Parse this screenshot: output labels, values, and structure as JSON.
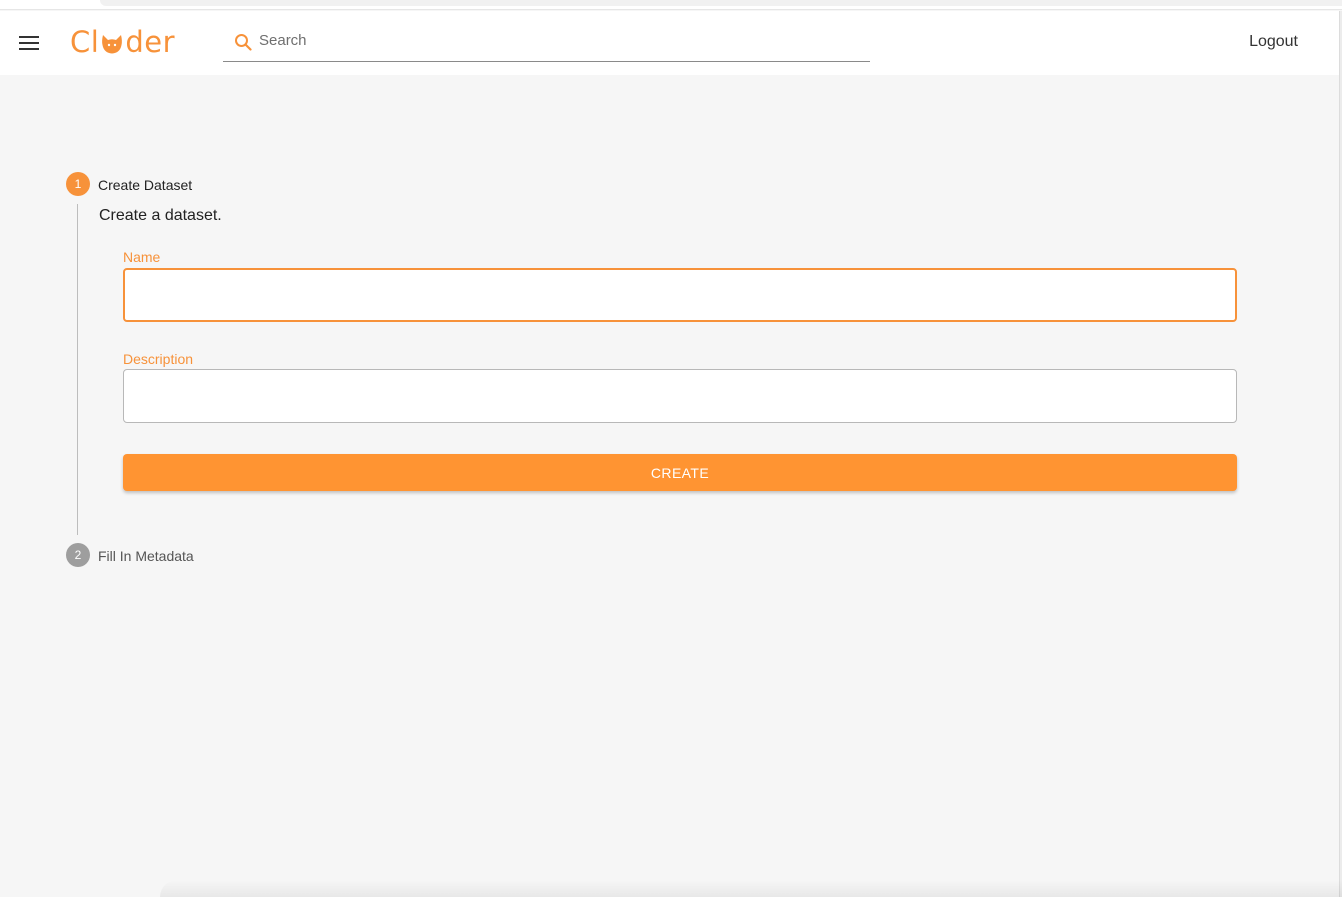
{
  "app": {
    "logo_text_left": "Cl",
    "logo_text_right": "der",
    "brand_color": "#f7923a"
  },
  "header": {
    "menu_icon": "hamburger-menu-icon",
    "search_icon": "search-icon",
    "search_placeholder": "Search",
    "search_value": "",
    "logout_label": "Logout"
  },
  "stepper": {
    "steps": [
      {
        "number": "1",
        "label": "Create Dataset",
        "state": "active",
        "color": "#f7923a"
      },
      {
        "number": "2",
        "label": "Fill In Metadata",
        "state": "inactive",
        "color": "#9e9e9e"
      }
    ],
    "active_step": {
      "description": "Create a dataset.",
      "fields": {
        "name": {
          "label": "Name",
          "value": ""
        },
        "description": {
          "label": "Description",
          "value": ""
        }
      },
      "submit_label": "CREATE",
      "button_color": "#ff9432"
    }
  }
}
